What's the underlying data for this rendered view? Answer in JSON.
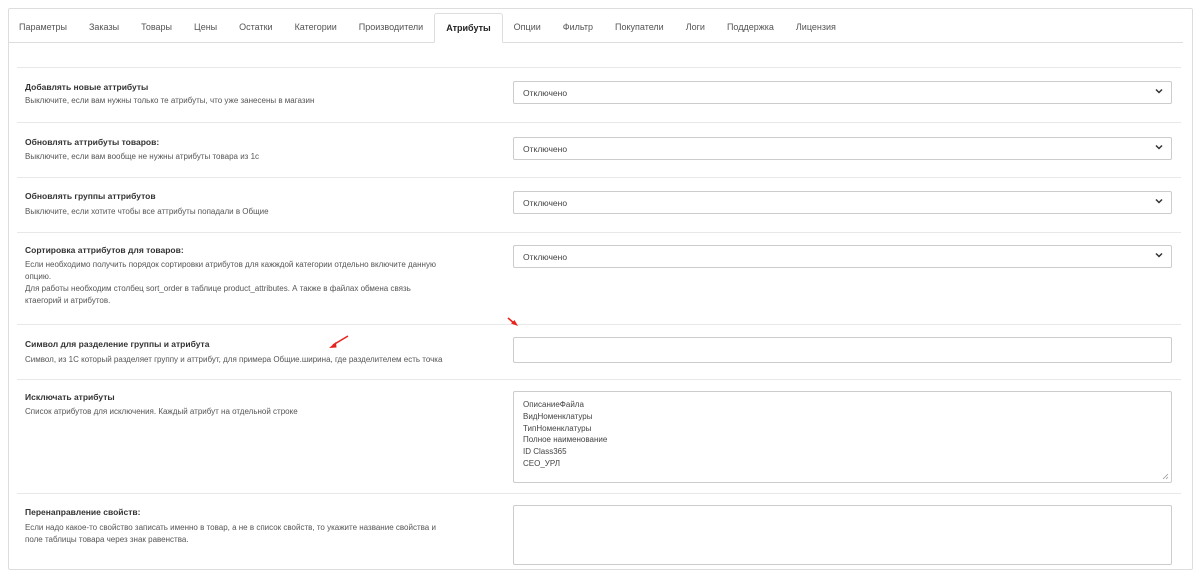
{
  "tabs": [
    {
      "label": "Параметры",
      "active": false
    },
    {
      "label": "Заказы",
      "active": false
    },
    {
      "label": "Товары",
      "active": false
    },
    {
      "label": "Цены",
      "active": false
    },
    {
      "label": "Остатки",
      "active": false
    },
    {
      "label": "Категории",
      "active": false
    },
    {
      "label": "Производители",
      "active": false
    },
    {
      "label": "Атрибуты",
      "active": true
    },
    {
      "label": "Опции",
      "active": false
    },
    {
      "label": "Фильтр",
      "active": false
    },
    {
      "label": "Покупатели",
      "active": false
    },
    {
      "label": "Логи",
      "active": false
    },
    {
      "label": "Поддержка",
      "active": false
    },
    {
      "label": "Лицензия",
      "active": false
    }
  ],
  "settings": {
    "add_new": {
      "title": "Добавлять новые аттрибуты",
      "desc": "Выключите, если вам нужны только те атрибуты, что уже занесены в магазин",
      "value": "Отключено"
    },
    "update_attrs": {
      "title": "Обновлять аттрибуты товаров:",
      "desc": "Выключите, если вам вообще не нужны атрибуты товара из 1с",
      "value": "Отключено"
    },
    "update_groups": {
      "title": "Обновлять группы аттрибутов",
      "desc": "Выключите, если хотите чтобы все аттрибуты попадали в Общие",
      "value": "Отключено"
    },
    "sort": {
      "title": "Сортировка аттрибутов для товаров:",
      "desc1": "Если необходимо получить порядок сортировки атрибутов для кажждой категории отдельно включите данную",
      "desc2": "опцию.",
      "desc3": "Для работы необходим столбец sort_order в таблице product_attributes. А также в файлах обмена связь",
      "desc4": "ктаегорий и атрибутов.",
      "value": "Отключено"
    },
    "separator": {
      "title": "Символ для разделение группы и атрибута",
      "desc": "Символ, из 1С который разделяет группу и аттрибут, для примера Общие.ширина, где разделителем есть точка",
      "value": ""
    },
    "exclude": {
      "title": "Исключать атрибуты",
      "desc": "Список атрибутов для исключения. Каждый атрибут на отдельной строке",
      "lines": [
        "ОписаниеФайла",
        "ВидНоменклатуры",
        "ТипНоменклатуры",
        "Полное наименование",
        "ID Class365",
        "СЕО_УРЛ"
      ]
    },
    "redirect": {
      "title": "Перенаправление свойств:",
      "desc1": "Если надо какое-то свойство записать именно в товар, а не в список свойств, то укажите название свойства и",
      "desc2": "поле таблицы товара через знак равенства."
    }
  },
  "colors": {
    "arrow": "#e8231c",
    "border": "#cccccc"
  }
}
